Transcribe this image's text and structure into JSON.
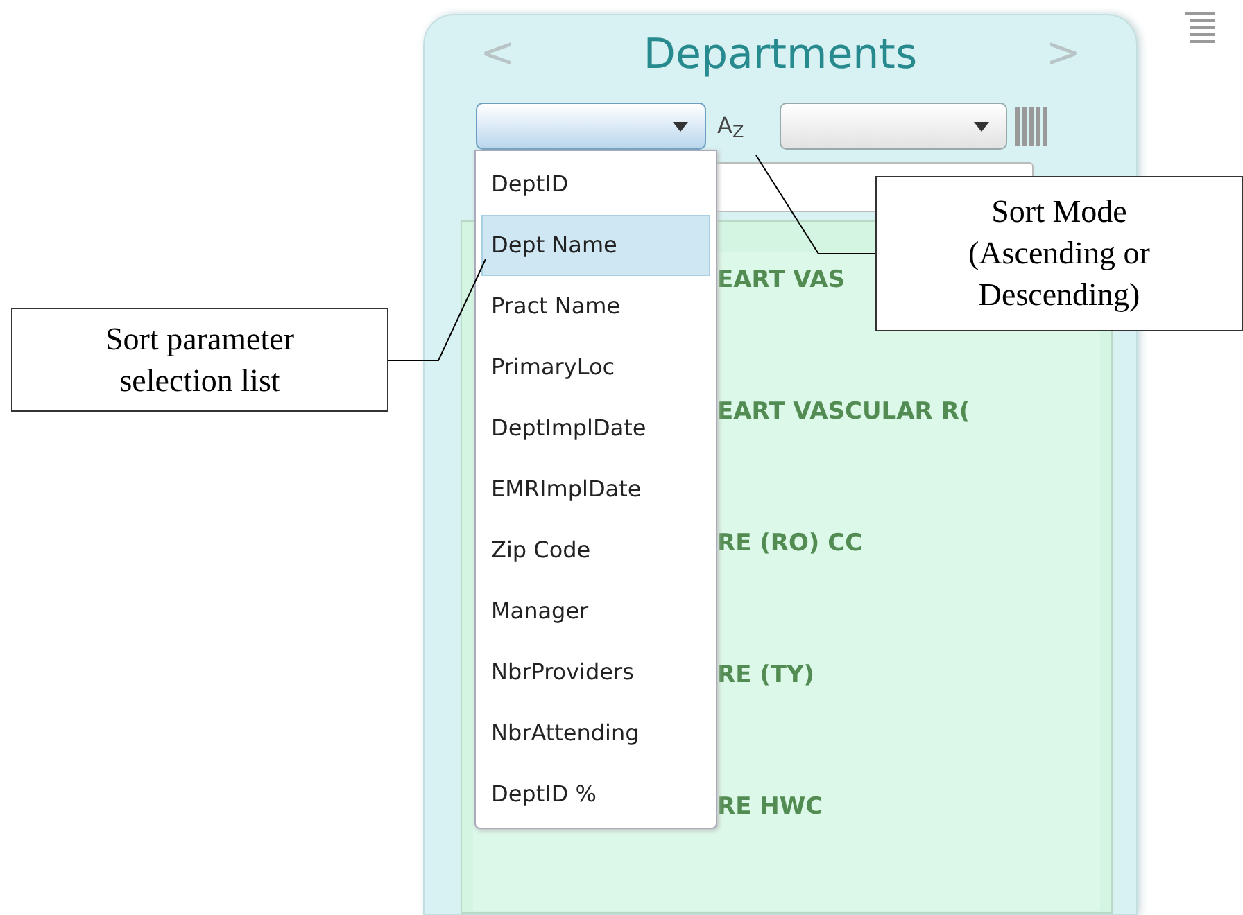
{
  "panel": {
    "prev": "<",
    "title": "Departments",
    "next": ">",
    "sort_mode": "A$_{Z}$",
    "rows": [
      {
        "name": "EART VAS"
      },
      {
        "name": "EART VASCULAR R("
      },
      {
        "name": "RE (RO) CC"
      },
      {
        "name": "RE (TY)"
      },
      {
        "name": "RE HWC"
      }
    ]
  },
  "sort_list": {
    "items": [
      {
        "label": "DeptID",
        "selected": false
      },
      {
        "label": "Dept Name",
        "selected": true
      },
      {
        "label": "Pract Name",
        "selected": false
      },
      {
        "label": "PrimaryLoc",
        "selected": false
      },
      {
        "label": "DeptImplDate",
        "selected": false
      },
      {
        "label": "EMRImplDate",
        "selected": false
      },
      {
        "label": "Zip Code",
        "selected": false
      },
      {
        "label": "Manager",
        "selected": false
      },
      {
        "label": "NbrProviders",
        "selected": false
      },
      {
        "label": "NbrAttending",
        "selected": false
      },
      {
        "label": "DeptID %",
        "selected": false
      }
    ]
  },
  "callouts": [
    {
      "text": "Sort Mode (Ascending or Descending)"
    },
    {
      "text": "Sort parameter selection list"
    }
  ]
}
